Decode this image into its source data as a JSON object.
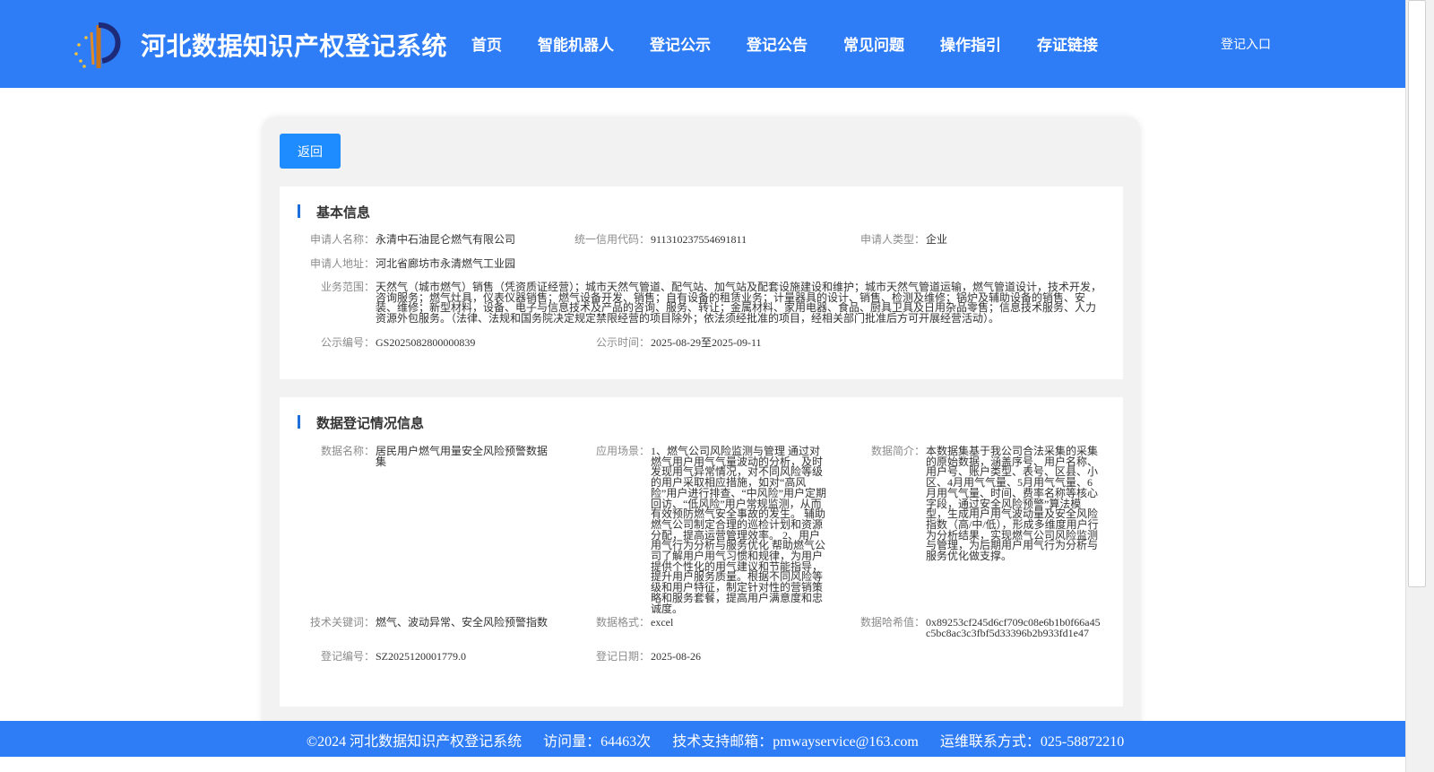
{
  "header": {
    "title": "河北数据知识产权登记系统",
    "nav": [
      "首页",
      "智能机器人",
      "登记公示",
      "登记公告",
      "常见问题",
      "操作指引",
      "存证链接"
    ],
    "login": "登记入口"
  },
  "back_button": "返回",
  "basic_info": {
    "title": "基本信息",
    "applicant_name": {
      "label": "申请人名称：",
      "value": "永清中石油昆仑燃气有限公司"
    },
    "credit_code": {
      "label": "统一信用代码：",
      "value": "911310237554691811"
    },
    "applicant_type": {
      "label": "申请人类型：",
      "value": "企业"
    },
    "applicant_address": {
      "label": "申请人地址：",
      "value": "河北省廊坊市永清燃气工业园"
    },
    "business_scope": {
      "label": "业务范围：",
      "value": "天然气（城市燃气）销售（凭资质证经营）；城市天然气管道、配气站、加气站及配套设施建设和维护；城市天然气管道运输，燃气管道设计，技术开发，咨询服务；燃气灶具，仪表仪器销售；燃气设备开发、销售；自有设备的租赁业务；计量器具的设计、销售、检测及维修；锅炉及辅助设备的销售、安装、维修；新型材料，设备、电子与信息技术及产品的咨询、服务、转让；金属材料、家用电器、食品、厨具卫具及日用杂品零售；信息技术服务、人力资源外包服务。（法律、法规和国务院决定规定禁限经营的项目除外；依法须经批准的项目，经相关部门批准后方可开展经营活动）。"
    },
    "publicity_no": {
      "label": "公示编号：",
      "value": "GS2025082800000839"
    },
    "publicity_time": {
      "label": "公示时间：",
      "value": "2025-08-29至2025-09-11"
    }
  },
  "data_info": {
    "title": "数据登记情况信息",
    "data_name": {
      "label": "数据名称：",
      "value": "居民用户燃气用量安全风险预警数据集"
    },
    "scenario": {
      "label": "应用场景：",
      "value": "1、燃气公司风险监测与管理 通过对燃气用户用气气量波动的分析，及时发现用气异常情况，对不同风险等级的用户采取相应措施，如对“高风险”用户进行排查、“中风险”用户定期回访、“低风险”用户常规监测，从而有效预防燃气安全事故的发生。 辅助燃气公司制定合理的巡检计划和资源分配，提高运营管理效率。 2、用户用气行为分析与服务优化 帮助燃气公司了解用户用气习惯和规律，为用户提供个性化的用气建议和节能指导，提升用户服务质量。根据不同风险等级和用户特征，制定针对性的营销策略和服务套餐，提高用户满意度和忠诚度。"
    },
    "summary": {
      "label": "数据简介：",
      "value": "本数据集基于我公司合法采集的采集的原始数据，涵盖序号、用户名称、用户号、账户类型、表号、区县、小区、4月用气气量、5月用气气量、6月用气气量、时间、费率名称等核心字段，通过安全风险预警”算法模型，生成用户用气波动量及安全风险指数（高/中/低），形成多维度用户行为分析结果，实现燃气公司风险监测与管理，为后期用户用气行为分析与服务优化做支撑。"
    },
    "keywords": {
      "label": "技术关键词：",
      "value": "燃气、波动异常、安全风险预警指数"
    },
    "format": {
      "label": "数据格式：",
      "value": "excel"
    },
    "hash": {
      "label": "数据哈希值：",
      "value": "0x89253cf245d6cf709c08e6b1b0f66a45c5bc8ac3c3fbf5d33396b2b933fd1e47"
    },
    "reg_no": {
      "label": "登记编号：",
      "value": "SZ2025120001779.0"
    },
    "reg_date": {
      "label": "登记日期：",
      "value": "2025-08-26"
    }
  },
  "footer": {
    "copyright": "©2024 河北数据知识产权登记系统",
    "visits": "访问量：64463次",
    "email": "技术支持邮箱：pmwayservice@163.com",
    "phone": "运维联系方式：025-58872210"
  }
}
